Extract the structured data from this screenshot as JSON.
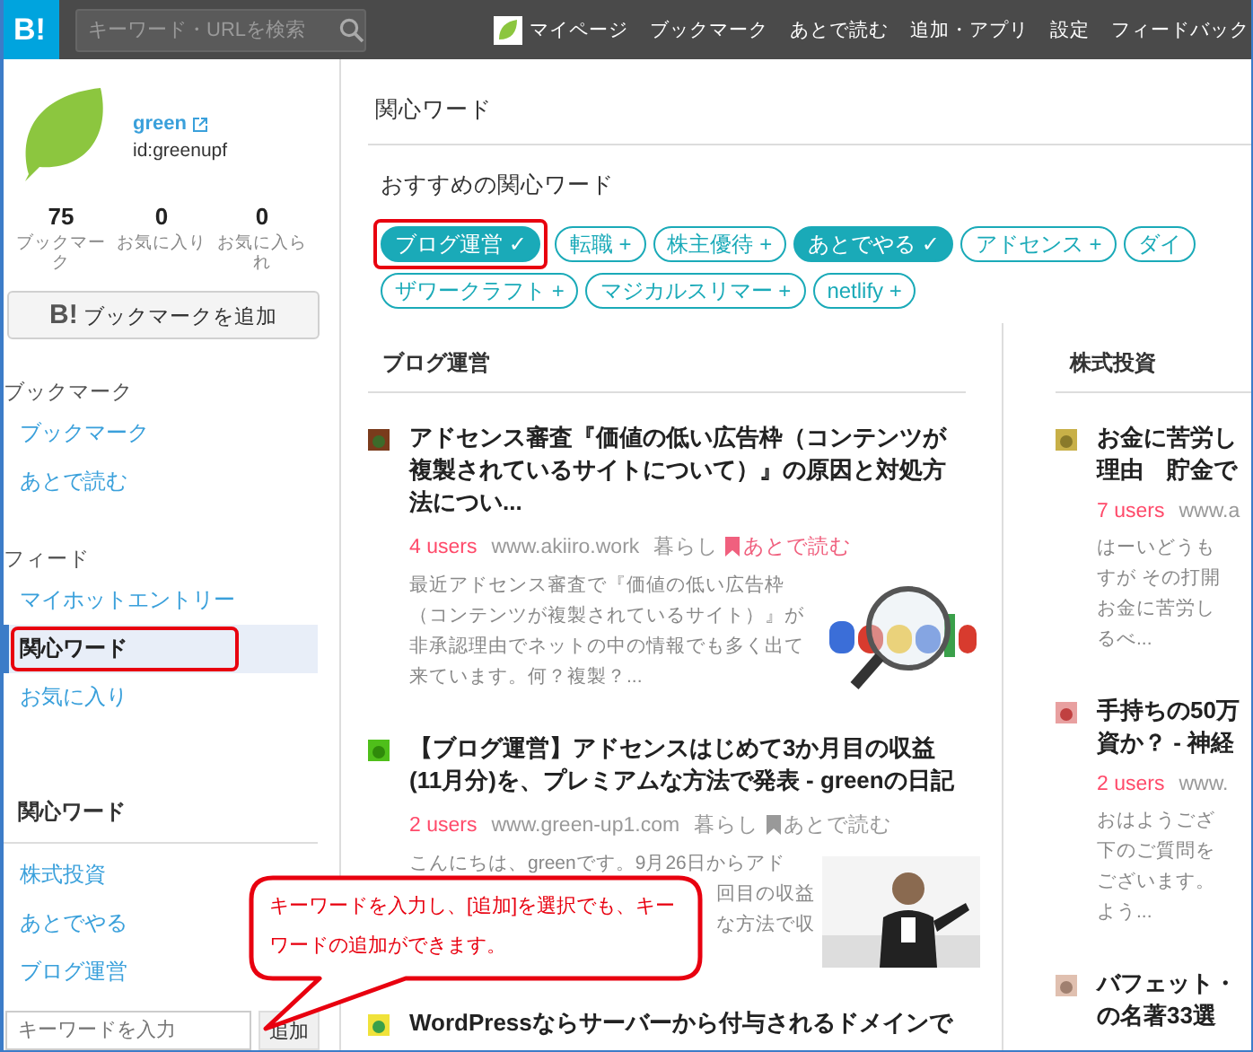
{
  "header": {
    "logo": "B!",
    "search": {
      "placeholder": "キーワード・URLを検索"
    },
    "nav": [
      {
        "label": "マイページ",
        "kind": "avatar"
      },
      {
        "label": "ブックマーク",
        "kind": "link"
      },
      {
        "label": "あとで読む",
        "kind": "link"
      },
      {
        "label": "追加・アプリ",
        "kind": "link"
      },
      {
        "label": "設定",
        "kind": "link"
      },
      {
        "label": "フィードバック",
        "kind": "link"
      }
    ]
  },
  "profile": {
    "name": "green",
    "id": "id:greenupf",
    "stats": [
      {
        "value": "75",
        "label": "ブックマーク"
      },
      {
        "value": "0",
        "label": "お気に入り"
      },
      {
        "value": "0",
        "label": "お気に入られ"
      }
    ],
    "add_button": {
      "mark": "B!",
      "label": "ブックマークを追加"
    }
  },
  "sidebar": {
    "sections": [
      {
        "title": "ブックマーク",
        "kind": "plain",
        "items": [
          {
            "label": "ブックマーク",
            "selected": false,
            "highlighted": false
          },
          {
            "label": "あとで読む",
            "selected": false,
            "highlighted": false
          }
        ]
      },
      {
        "title": "フィード",
        "kind": "plain",
        "items": [
          {
            "label": "マイホットエントリー",
            "selected": false,
            "highlighted": false
          },
          {
            "label": "関心ワード",
            "selected": true,
            "highlighted": true
          },
          {
            "label": "お気に入り",
            "selected": false,
            "highlighted": false
          }
        ]
      },
      {
        "title": "関心ワード",
        "kind": "bold",
        "items": [
          {
            "label": "株式投資",
            "selected": false,
            "highlighted": false
          },
          {
            "label": "あとでやる",
            "selected": false,
            "highlighted": false
          },
          {
            "label": "ブログ運営",
            "selected": false,
            "highlighted": false
          }
        ]
      }
    ],
    "keyword_input": {
      "placeholder": "キーワードを入力"
    },
    "add_button": "追加"
  },
  "main": {
    "title": "関心ワード",
    "recommended": {
      "title": "おすすめの関心ワード",
      "tags": [
        {
          "label": "ブログ運営",
          "mark": "✓",
          "selected": true,
          "highlighted": true
        },
        {
          "label": "転職",
          "mark": "+",
          "selected": false,
          "highlighted": false
        },
        {
          "label": "株主優待",
          "mark": "+",
          "selected": false,
          "highlighted": false
        },
        {
          "label": "あとでやる",
          "mark": "✓",
          "selected": true,
          "highlighted": false
        },
        {
          "label": "アドセンス",
          "mark": "+",
          "selected": false,
          "highlighted": false
        },
        {
          "label": "ダイ",
          "selected": false,
          "highlighted": false
        },
        {
          "label": "ザワークラフト",
          "mark": "+",
          "selected": false,
          "highlighted": false
        },
        {
          "label": "マジカルスリマー",
          "mark": "+",
          "selected": false,
          "highlighted": false
        },
        {
          "label": "netlify",
          "mark": "+",
          "selected": false,
          "highlighted": false
        }
      ]
    },
    "columns": [
      {
        "title": "ブログ運営",
        "articles": [
          {
            "title_lines": [
              "アドセンス審査『価値の低い広告枠（コンテンツが",
              "複製されているサイトについて）』の原因と対処方",
              "法につい..."
            ],
            "users": "4 users",
            "domain": "www.akiiro.work",
            "category": "暮らし",
            "read_later": {
              "label": "あとで読む",
              "saved": true
            },
            "excerpt_lines": [
              "最近アドセンス審査で『価値の低い広告枠",
              "（コンテンツが複製されているサイト）』が",
              "非承認理由でネットの中の情報でも多く出て",
              "来ています。何？複製？..."
            ],
            "thumbnail": {
              "kind": "picture"
            }
          },
          {
            "title_lines": [
              "【ブログ運営】アドセンスはじめて3か月目の収益",
              "(11月分)を、プレミアムな方法で発表 - greenの日記"
            ],
            "users": "2 users",
            "domain": "www.green-up1.com",
            "category": "暮らし",
            "read_later": {
              "label": "あとで読む",
              "saved": false
            },
            "excerpt_lines": [
              "こんにちは、greenです。9月26日からアド"
            ],
            "excerpt_line_ends": [
              "回目の収益",
              "な方法で収"
            ],
            "thumbnail": {
              "kind": "picture"
            }
          },
          {
            "title_lines": [
              "WordPressならサーバーから付与されるドメインで"
            ]
          }
        ]
      },
      {
        "title": "株式投資",
        "articles": [
          {
            "title_lines": [
              "お金に苦労し",
              "理由　貯金で"
            ],
            "users": "7 users",
            "domain": "www.a",
            "excerpt_lines": [
              "はーいどうも",
              "すが その打開",
              "お金に苦労し",
              "るべ..."
            ]
          },
          {
            "title_lines": [
              "手持ちの50万",
              "資か？ - 神経"
            ],
            "users": "2 users",
            "domain": "www.",
            "excerpt_lines": [
              "おはようござ",
              "下のご質問を",
              "ございます。",
              "よう..."
            ]
          },
          {
            "title_lines": [
              "バフェット・",
              "の名著33選"
            ]
          }
        ]
      }
    ]
  },
  "callout": {
    "text": "キーワードを入力し、[追加]を選択でも、キーワードの追加ができます。"
  }
}
